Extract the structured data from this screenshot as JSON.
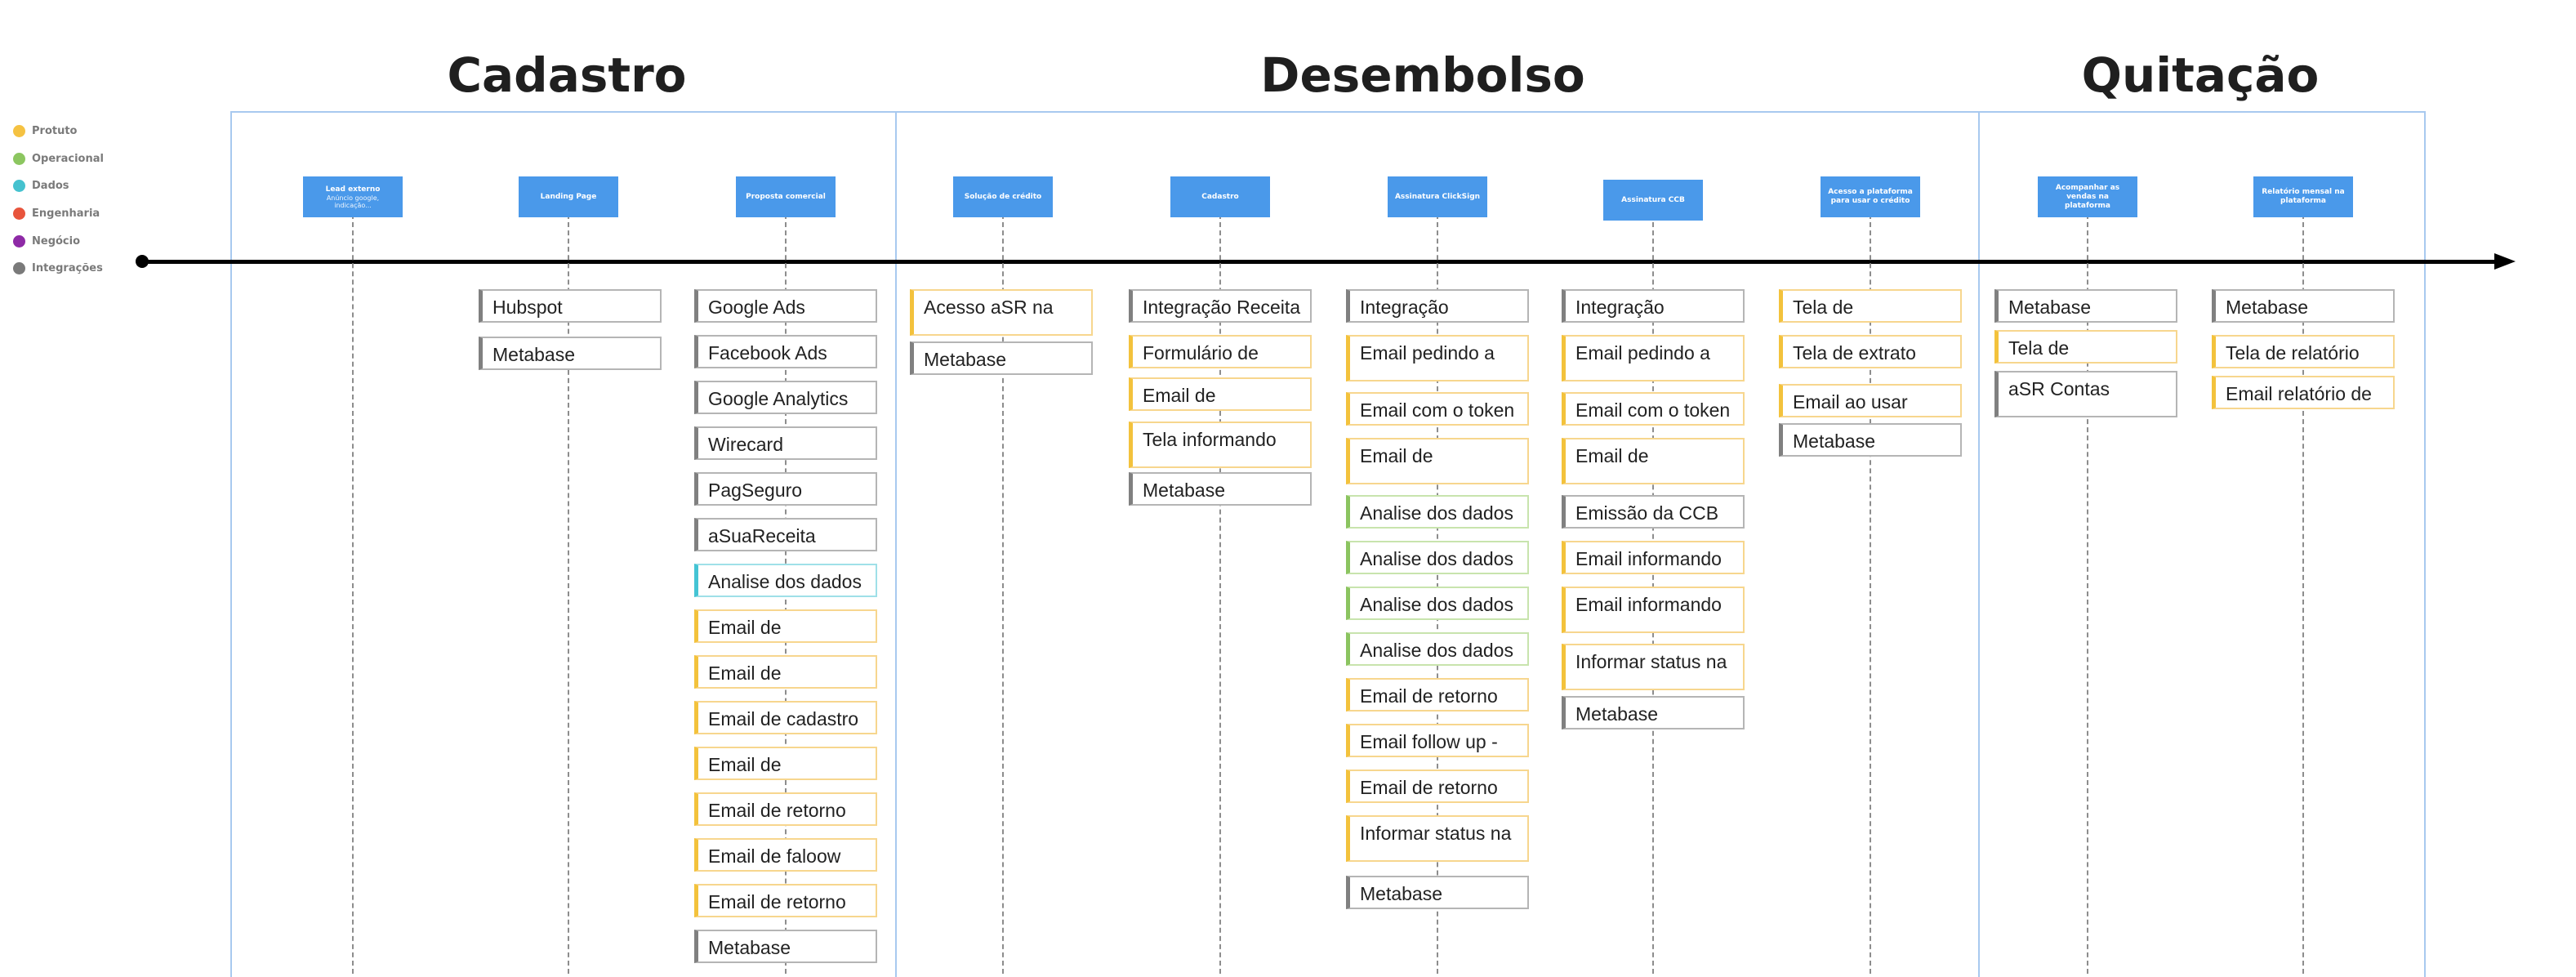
{
  "phases": [
    "Cadastro",
    "Desembolso",
    "Quitação"
  ],
  "legend": [
    {
      "label": "Protuto",
      "color": "#f5c242"
    },
    {
      "label": "Operacional",
      "color": "#8cc660"
    },
    {
      "label": "Dados",
      "color": "#45c2cf"
    },
    {
      "label": "Engenharia",
      "color": "#e8543c"
    },
    {
      "label": "Negócio",
      "color": "#8e2aa6"
    },
    {
      "label": "Integrações",
      "color": "#7a7a7a"
    }
  ],
  "colors": {
    "stage": "#4a99ea",
    "frame": "#a8c9ef",
    "yellow": "#f3c23c",
    "gray": "#808080",
    "green": "#8bc460",
    "teal": "#44c4d4"
  },
  "stages": [
    {
      "title": "Lead externo",
      "subtitle": "Anúncio google, indicação...",
      "cards": []
    },
    {
      "title": "Landing Page",
      "subtitle": "",
      "cards": [
        {
          "text": "Hubspot",
          "color": "gray"
        },
        {
          "text": "Metabase",
          "color": "gray"
        }
      ]
    },
    {
      "title": "Proposta comercial",
      "subtitle": "",
      "cards": [
        {
          "text": "Google Ads",
          "color": "gray"
        },
        {
          "text": "Facebook Ads",
          "color": "gray"
        },
        {
          "text": "Google Analytics",
          "color": "gray"
        },
        {
          "text": "Wirecard",
          "color": "gray"
        },
        {
          "text": "PagSeguro",
          "color": "gray"
        },
        {
          "text": "aSuaReceita",
          "color": "gray"
        },
        {
          "text": "Analise dos dados",
          "color": "teal"
        },
        {
          "text": "Email de",
          "color": "yellow"
        },
        {
          "text": "Email de",
          "color": "yellow"
        },
        {
          "text": "Email de cadastro",
          "color": "yellow"
        },
        {
          "text": "Email de",
          "color": "yellow"
        },
        {
          "text": "Email de retorno",
          "color": "yellow"
        },
        {
          "text": "Email de faloow",
          "color": "yellow"
        },
        {
          "text": "Email de retorno",
          "color": "yellow"
        },
        {
          "text": "Metabase",
          "color": "gray"
        }
      ]
    },
    {
      "title": "Solução de crédito",
      "subtitle": "",
      "cards": [
        {
          "text": "Acesso  aSR na",
          "color": "yellow",
          "tall": true
        },
        {
          "text": "Metabase",
          "color": "gray"
        }
      ]
    },
    {
      "title": "Cadastro",
      "subtitle": "",
      "cards": [
        {
          "text": "Integração Receita",
          "color": "gray"
        },
        {
          "text": "Formulário de",
          "color": "yellow"
        },
        {
          "text": "Email de",
          "color": "yellow"
        },
        {
          "text": "Tela informando",
          "color": "yellow",
          "tall": true
        },
        {
          "text": "Metabase",
          "color": "gray"
        }
      ]
    },
    {
      "title": "Assinatura ClickSign",
      "subtitle": "",
      "cards": [
        {
          "text": "Integração",
          "color": "gray"
        },
        {
          "text": "Email pedindo a",
          "color": "yellow",
          "tall": true
        },
        {
          "text": "Email com o token",
          "color": "yellow"
        },
        {
          "text": "Email de",
          "color": "yellow",
          "tall": true
        },
        {
          "text": "Analise dos dados",
          "color": "green"
        },
        {
          "text": "Analise dos dados",
          "color": "green"
        },
        {
          "text": "Analise dos dados",
          "color": "green"
        },
        {
          "text": "Analise dos dados",
          "color": "green"
        },
        {
          "text": "Email de retorno",
          "color": "yellow"
        },
        {
          "text": "Email follow up -",
          "color": "yellow"
        },
        {
          "text": "Email de retorno",
          "color": "yellow"
        },
        {
          "text": "Informar status na",
          "color": "yellow",
          "tall": true
        },
        {
          "text": "Metabase",
          "color": "gray"
        }
      ]
    },
    {
      "title": "Assinatura CCB",
      "subtitle": "",
      "cards": [
        {
          "text": "Integração",
          "color": "gray"
        },
        {
          "text": "Email pedindo a",
          "color": "yellow",
          "tall": true
        },
        {
          "text": "Email com o token",
          "color": "yellow"
        },
        {
          "text": "Email de",
          "color": "yellow",
          "tall": true
        },
        {
          "text": "Emissão da CCB",
          "color": "gray"
        },
        {
          "text": "Email informando",
          "color": "yellow"
        },
        {
          "text": "Email informando",
          "color": "yellow",
          "tall": true
        },
        {
          "text": "Informar status na",
          "color": "yellow",
          "tall": true
        },
        {
          "text": "Metabase",
          "color": "gray"
        }
      ]
    },
    {
      "title": "Acesso a plataforma para usar o crédito",
      "subtitle": "",
      "cards": [
        {
          "text": "Tela de",
          "color": "yellow"
        },
        {
          "text": "Tela de extrato",
          "color": "yellow"
        },
        {
          "text": "Email ao usar",
          "color": "yellow"
        },
        {
          "text": "Metabase",
          "color": "gray"
        }
      ]
    },
    {
      "title": "Acompanhar as vendas na plataforma",
      "subtitle": "",
      "cards": [
        {
          "text": "Metabase",
          "color": "gray"
        },
        {
          "text": "Tela de",
          "color": "yellow"
        },
        {
          "text": "aSR Contas",
          "color": "gray",
          "tall": true
        }
      ]
    },
    {
      "title": "Relatório mensal na plataforma",
      "subtitle": "",
      "cards": [
        {
          "text": "Metabase",
          "color": "gray"
        },
        {
          "text": "Tela de relatório",
          "color": "yellow"
        },
        {
          "text": "Email relatório de",
          "color": "yellow"
        }
      ]
    }
  ]
}
